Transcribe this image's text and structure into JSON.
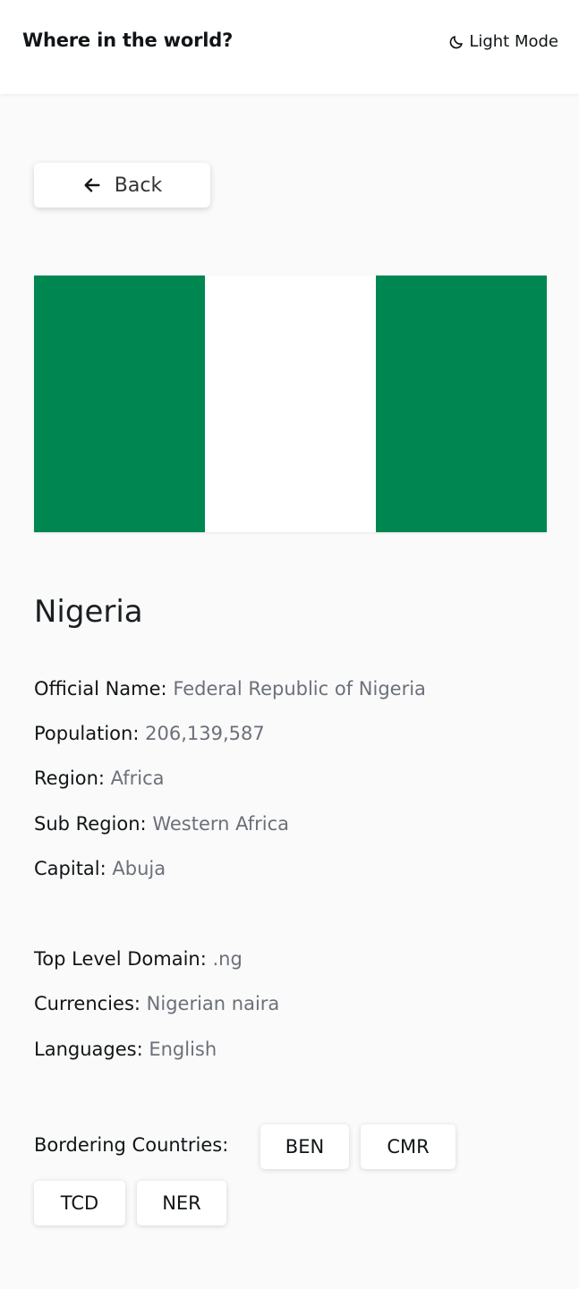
{
  "header": {
    "title": "Where in the world?",
    "theme_toggle_label": "Light Mode",
    "theme_toggle_icon": "moon-icon"
  },
  "back_button": {
    "label": "Back",
    "icon": "arrow-left-icon"
  },
  "flag": {
    "colors": [
      "#008751",
      "#ffffff",
      "#008751"
    ]
  },
  "country": {
    "name": "Nigeria",
    "details": [
      {
        "label": "Official Name:",
        "value": "Federal Republic of Nigeria"
      },
      {
        "label": "Population:",
        "value": "206,139,587"
      },
      {
        "label": "Region:",
        "value": "Africa"
      },
      {
        "label": "Sub Region:",
        "value": "Western Africa"
      },
      {
        "label": "Capital:",
        "value": "Abuja"
      }
    ],
    "extra": [
      {
        "label": "Top Level Domain:",
        "value": ".ng"
      },
      {
        "label": "Currencies:",
        "value": "Nigerian naira"
      },
      {
        "label": "Languages:",
        "value": "English"
      }
    ],
    "borders_label": "Bordering Countries:",
    "borders": [
      "BEN",
      "CMR",
      "TCD",
      "NER"
    ]
  }
}
